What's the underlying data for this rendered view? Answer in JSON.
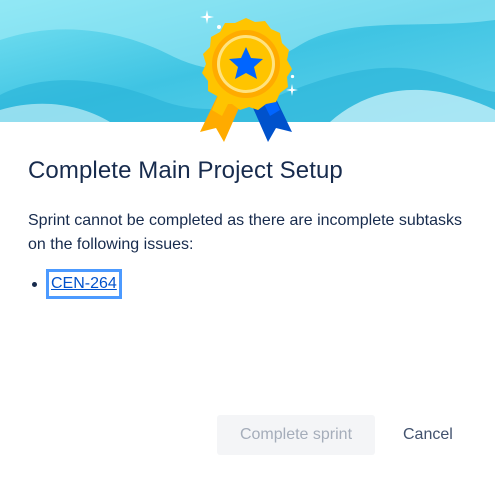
{
  "dialog": {
    "title": "Complete Main Project Setup",
    "message": "Sprint cannot be completed as there are incomplete subtasks on the following issues:",
    "issues": [
      {
        "key": "CEN-264"
      }
    ],
    "buttons": {
      "complete_label": "Complete sprint",
      "cancel_label": "Cancel"
    },
    "icons": {
      "header": "award-badge-icon",
      "sparkles": "sparkle-icon"
    },
    "colors": {
      "header_bg": "#4fd2e8",
      "badge_gold": "#ffc400",
      "badge_star": "#0065ff",
      "ribbon_blue": "#0052cc",
      "title": "#172b4d",
      "link": "#0052cc",
      "focus_ring": "#4c9aff"
    }
  }
}
